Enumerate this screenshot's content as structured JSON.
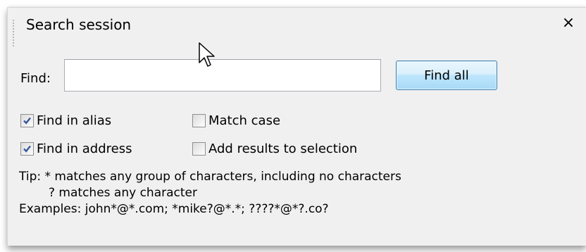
{
  "panel": {
    "title": "Search session",
    "close_label": "×"
  },
  "find": {
    "label": "Find:",
    "value": "",
    "placeholder": "",
    "button_label": "Find all"
  },
  "options": [
    {
      "label": "Find in alias",
      "checked": true
    },
    {
      "label": "Match case",
      "checked": false
    },
    {
      "label": "Find in address",
      "checked": true
    },
    {
      "label": "Add results to selection",
      "checked": false
    }
  ],
  "tip": {
    "line1": "Tip: * matches any group of characters, including no characters",
    "line2": "? matches any character",
    "line3": "Examples: john*@*.com; *mike?@*.*; ????*@*?.co?"
  },
  "colors": {
    "panel_bg": "#f0f0f0",
    "check_mark": "#3a58a0",
    "button_border": "#3c7fb1"
  }
}
